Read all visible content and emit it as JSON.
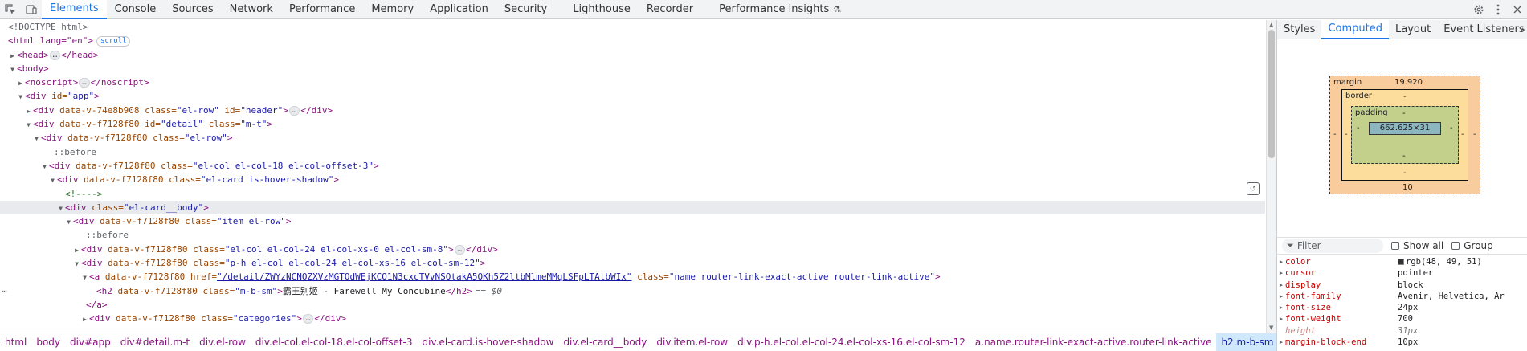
{
  "toolbar": {
    "tabs": [
      "Elements",
      "Console",
      "Sources",
      "Network",
      "Performance",
      "Memory",
      "Application",
      "Security",
      "Lighthouse",
      "Recorder",
      "Performance insights"
    ],
    "active_tab": "Elements"
  },
  "dom": {
    "doctype": "<!DOCTYPE html>",
    "html_open": "<html lang=\"en\">",
    "scroll_badge": "scroll",
    "lines": {
      "head": "<head>",
      "head_close": "</head>",
      "body": "<body>",
      "noscript": "<noscript>",
      "noscript_close": "</noscript>",
      "app_tag": "<div ",
      "app_attr": "id=",
      "app_val": "\"app\"",
      "app_end": ">",
      "header_tag": "<div ",
      "header_attr1": "data-v-74e8b908 class=",
      "header_val1": "\"el-row\"",
      "header_attr2": " id=",
      "header_val2": "\"header\"",
      "header_end": ">",
      "header_close": "</div>",
      "detail_tag": "<div ",
      "detail_attr1": "data-v-f7128f80 id=",
      "detail_val1": "\"detail\"",
      "detail_attr2": " class=",
      "detail_val2": "\"m-t\"",
      "detail_end": ">",
      "row_tag": "<div ",
      "row_attr": "data-v-f7128f80 class=",
      "row_val": "\"el-row\"",
      "row_end": ">",
      "before1": "::before",
      "col_tag": "<div ",
      "col_attr": "data-v-f7128f80 class=",
      "col_val": "\"el-col el-col-18 el-col-offset-3\"",
      "col_end": ">",
      "card_tag": "<div ",
      "card_attr": "data-v-f7128f80 class=",
      "card_val": "\"el-card is-hover-shadow\"",
      "card_end": ">",
      "comment": "<!---->",
      "cardbody_tag": "<div ",
      "cardbody_attr": "class=",
      "cardbody_val": "\"el-card__body\"",
      "cardbody_end": ">",
      "item_tag": "<div ",
      "item_attr": "data-v-f7128f80 class=",
      "item_val": "\"item el-row\"",
      "item_end": ">",
      "before2": "::before",
      "col24_tag": "<div ",
      "col24_attr": "data-v-f7128f80 class=",
      "col24_val": "\"el-col el-col-24 el-col-xs-0 el-col-sm-8\"",
      "col24_end": ">",
      "col24_close": "</div>",
      "ph_tag": "<div ",
      "ph_attr": "data-v-f7128f80 class=",
      "ph_val": "\"p-h el-col el-col-24 el-col-xs-16 el-col-sm-12\"",
      "ph_end": ">",
      "a_tag": "<a ",
      "a_attr1": "data-v-f7128f80 href=",
      "a_href": "\"/detail/ZWYzNCNOZXVzMGTOdWEjKCO1N3cxcTVvNSOtakA5OKh5Z2ltbMlmeMMqLSFpLTAtbWIx\"",
      "a_attr2": " class=",
      "a_val2": "\"name router-link-exact-active router-link-active\"",
      "a_end": ">",
      "h2_tag": "<h2 ",
      "h2_attr": "data-v-f7128f80 class=",
      "h2_val": "\"m-b-sm\"",
      "h2_end": ">",
      "h2_text": "霸王别姬 - Farewell My Concubine",
      "h2_close": "</h2>",
      "h2_eq": "== $0",
      "a_close": "</a>",
      "cat_tag": "<div ",
      "cat_attr": "data-v-f7128f80 class=",
      "cat_val": "\"categories\"",
      "cat_end": ">",
      "cat_close": "</div>"
    }
  },
  "breadcrumbs": [
    "html",
    "body",
    "div#app",
    "div#detail.m-t",
    "div.el-row",
    "div.el-col.el-col-18.el-col-offset-3",
    "div.el-card.is-hover-shadow",
    "div.el-card__body",
    "div.item.el-row",
    "div.p-h.el-col.el-col-24.el-col-xs-16.el-col-sm-12",
    "a.name.router-link-exact-active.router-link-active",
    "h2.m-b-sm"
  ],
  "side": {
    "tabs": [
      "Styles",
      "Computed",
      "Layout",
      "Event Listeners"
    ],
    "active_tab": "Computed",
    "more": "»",
    "box_model": {
      "margin_label": "margin",
      "margin_top": "19.920",
      "margin_bottom": "10",
      "margin_left": "-",
      "margin_right": "-",
      "border_label": "border",
      "border_top": "-",
      "border_bottom": "-",
      "border_left": "-",
      "border_right": "-",
      "padding_label": "padding",
      "padding_top": "-",
      "padding_bottom": "-",
      "padding_left": "-",
      "padding_right": "-",
      "content": "662.625×31"
    },
    "filter_placeholder": "Filter",
    "show_all": "Show all",
    "group": "Group",
    "properties": [
      {
        "name": "color",
        "value": "rgb(48, 49, 51)",
        "swatch": "#303133",
        "inherited": false
      },
      {
        "name": "cursor",
        "value": "pointer",
        "inherited": false
      },
      {
        "name": "display",
        "value": "block",
        "inherited": false
      },
      {
        "name": "font-family",
        "value": "Avenir, Helvetica, Ar",
        "inherited": false
      },
      {
        "name": "font-size",
        "value": "24px",
        "inherited": false
      },
      {
        "name": "font-weight",
        "value": "700",
        "inherited": false
      },
      {
        "name": "height",
        "value": "31px",
        "inherited": true
      },
      {
        "name": "margin-block-end",
        "value": "10px",
        "inherited": false
      }
    ]
  }
}
